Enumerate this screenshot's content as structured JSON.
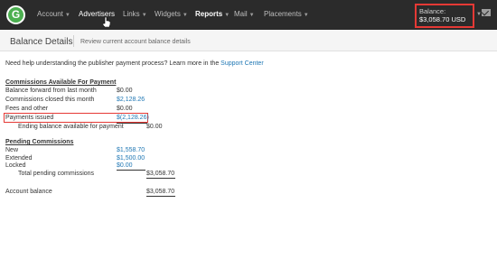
{
  "nav": {
    "logo_letter": "G",
    "items": [
      {
        "label": "Account"
      },
      {
        "label": "Advertisers"
      },
      {
        "label": "Links"
      },
      {
        "label": "Widgets"
      },
      {
        "label": "Reports"
      },
      {
        "label": "Mail"
      },
      {
        "label": "Placements"
      }
    ],
    "balance_label": "Balance:",
    "balance_value": "$3,058.70 USD"
  },
  "subheader": {
    "title": "Balance Details",
    "subtitle": "Review current account balance details"
  },
  "help": {
    "text": "Need help understanding the publisher payment process? Learn more in the",
    "link": "Support Center"
  },
  "commissions_available": {
    "title": "Commissions Available For Payment",
    "rows": [
      {
        "label": "Balance forward from last month",
        "value": "$0.00"
      },
      {
        "label": "Commissions closed this month",
        "value": "$2,128.26"
      },
      {
        "label": "Fees and other",
        "value": "$0.00"
      },
      {
        "label": "Payments issued",
        "value": "$(2,128.26)"
      }
    ],
    "ending_label": "Ending balance available for payment",
    "ending_value": "$0.00"
  },
  "pending": {
    "title": "Pending Commissions",
    "rows": [
      {
        "label": "New",
        "value": "$1,558.70"
      },
      {
        "label": "Extended",
        "value": "$1,500.00"
      },
      {
        "label": "Locked",
        "value": "$0.00"
      }
    ],
    "total_label": "Total pending commissions",
    "total_value": "$3,058.70"
  },
  "account": {
    "label": "Account balance",
    "value": "$3,058.70"
  },
  "colors": {
    "nav_bg": "#2b2b2b",
    "logo_green": "#4caf50",
    "link_blue": "#1f77b4",
    "highlight_red": "#e53935"
  }
}
